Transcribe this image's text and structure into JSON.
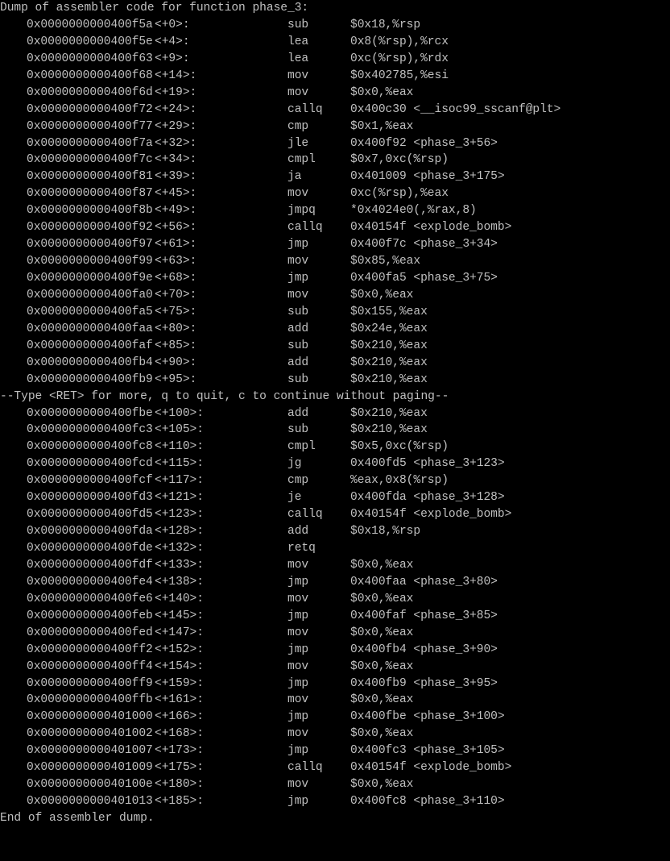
{
  "terminal": {
    "header": "Dump of assembler code for function phase_3:",
    "pager_prompt": "--Type <RET> for more, q to quit, c to continue without paging--",
    "footer": "End of assembler dump.",
    "colors": {
      "background": "#000000",
      "text": "#c0c0c0"
    },
    "instructions_part1": [
      {
        "address": "0x0000000000400f5a",
        "offset": "<+0>:",
        "mnemonic": "sub",
        "operands": "$0x18,%rsp"
      },
      {
        "address": "0x0000000000400f5e",
        "offset": "<+4>:",
        "mnemonic": "lea",
        "operands": "0x8(%rsp),%rcx"
      },
      {
        "address": "0x0000000000400f63",
        "offset": "<+9>:",
        "mnemonic": "lea",
        "operands": "0xc(%rsp),%rdx"
      },
      {
        "address": "0x0000000000400f68",
        "offset": "<+14>:",
        "mnemonic": "mov",
        "operands": "$0x402785,%esi"
      },
      {
        "address": "0x0000000000400f6d",
        "offset": "<+19>:",
        "mnemonic": "mov",
        "operands": "$0x0,%eax"
      },
      {
        "address": "0x0000000000400f72",
        "offset": "<+24>:",
        "mnemonic": "callq",
        "operands": "0x400c30 <__isoc99_sscanf@plt>"
      },
      {
        "address": "0x0000000000400f77",
        "offset": "<+29>:",
        "mnemonic": "cmp",
        "operands": "$0x1,%eax"
      },
      {
        "address": "0x0000000000400f7a",
        "offset": "<+32>:",
        "mnemonic": "jle",
        "operands": "0x400f92 <phase_3+56>"
      },
      {
        "address": "0x0000000000400f7c",
        "offset": "<+34>:",
        "mnemonic": "cmpl",
        "operands": "$0x7,0xc(%rsp)"
      },
      {
        "address": "0x0000000000400f81",
        "offset": "<+39>:",
        "mnemonic": "ja",
        "operands": "0x401009 <phase_3+175>"
      },
      {
        "address": "0x0000000000400f87",
        "offset": "<+45>:",
        "mnemonic": "mov",
        "operands": "0xc(%rsp),%eax"
      },
      {
        "address": "0x0000000000400f8b",
        "offset": "<+49>:",
        "mnemonic": "jmpq",
        "operands": "*0x4024e0(,%rax,8)"
      },
      {
        "address": "0x0000000000400f92",
        "offset": "<+56>:",
        "mnemonic": "callq",
        "operands": "0x40154f <explode_bomb>"
      },
      {
        "address": "0x0000000000400f97",
        "offset": "<+61>:",
        "mnemonic": "jmp",
        "operands": "0x400f7c <phase_3+34>"
      },
      {
        "address": "0x0000000000400f99",
        "offset": "<+63>:",
        "mnemonic": "mov",
        "operands": "$0x85,%eax"
      },
      {
        "address": "0x0000000000400f9e",
        "offset": "<+68>:",
        "mnemonic": "jmp",
        "operands": "0x400fa5 <phase_3+75>"
      },
      {
        "address": "0x0000000000400fa0",
        "offset": "<+70>:",
        "mnemonic": "mov",
        "operands": "$0x0,%eax"
      },
      {
        "address": "0x0000000000400fa5",
        "offset": "<+75>:",
        "mnemonic": "sub",
        "operands": "$0x155,%eax"
      },
      {
        "address": "0x0000000000400faa",
        "offset": "<+80>:",
        "mnemonic": "add",
        "operands": "$0x24e,%eax"
      },
      {
        "address": "0x0000000000400faf",
        "offset": "<+85>:",
        "mnemonic": "sub",
        "operands": "$0x210,%eax"
      },
      {
        "address": "0x0000000000400fb4",
        "offset": "<+90>:",
        "mnemonic": "add",
        "operands": "$0x210,%eax"
      },
      {
        "address": "0x0000000000400fb9",
        "offset": "<+95>:",
        "mnemonic": "sub",
        "operands": "$0x210,%eax"
      }
    ],
    "instructions_part2": [
      {
        "address": "0x0000000000400fbe",
        "offset": "<+100>:",
        "mnemonic": "add",
        "operands": "$0x210,%eax"
      },
      {
        "address": "0x0000000000400fc3",
        "offset": "<+105>:",
        "mnemonic": "sub",
        "operands": "$0x210,%eax"
      },
      {
        "address": "0x0000000000400fc8",
        "offset": "<+110>:",
        "mnemonic": "cmpl",
        "operands": "$0x5,0xc(%rsp)"
      },
      {
        "address": "0x0000000000400fcd",
        "offset": "<+115>:",
        "mnemonic": "jg",
        "operands": "0x400fd5 <phase_3+123>"
      },
      {
        "address": "0x0000000000400fcf",
        "offset": "<+117>:",
        "mnemonic": "cmp",
        "operands": "%eax,0x8(%rsp)"
      },
      {
        "address": "0x0000000000400fd3",
        "offset": "<+121>:",
        "mnemonic": "je",
        "operands": "0x400fda <phase_3+128>"
      },
      {
        "address": "0x0000000000400fd5",
        "offset": "<+123>:",
        "mnemonic": "callq",
        "operands": "0x40154f <explode_bomb>"
      },
      {
        "address": "0x0000000000400fda",
        "offset": "<+128>:",
        "mnemonic": "add",
        "operands": "$0x18,%rsp"
      },
      {
        "address": "0x0000000000400fde",
        "offset": "<+132>:",
        "mnemonic": "retq",
        "operands": ""
      },
      {
        "address": "0x0000000000400fdf",
        "offset": "<+133>:",
        "mnemonic": "mov",
        "operands": "$0x0,%eax"
      },
      {
        "address": "0x0000000000400fe4",
        "offset": "<+138>:",
        "mnemonic": "jmp",
        "operands": "0x400faa <phase_3+80>"
      },
      {
        "address": "0x0000000000400fe6",
        "offset": "<+140>:",
        "mnemonic": "mov",
        "operands": "$0x0,%eax"
      },
      {
        "address": "0x0000000000400feb",
        "offset": "<+145>:",
        "mnemonic": "jmp",
        "operands": "0x400faf <phase_3+85>"
      },
      {
        "address": "0x0000000000400fed",
        "offset": "<+147>:",
        "mnemonic": "mov",
        "operands": "$0x0,%eax"
      },
      {
        "address": "0x0000000000400ff2",
        "offset": "<+152>:",
        "mnemonic": "jmp",
        "operands": "0x400fb4 <phase_3+90>"
      },
      {
        "address": "0x0000000000400ff4",
        "offset": "<+154>:",
        "mnemonic": "mov",
        "operands": "$0x0,%eax"
      },
      {
        "address": "0x0000000000400ff9",
        "offset": "<+159>:",
        "mnemonic": "jmp",
        "operands": "0x400fb9 <phase_3+95>"
      },
      {
        "address": "0x0000000000400ffb",
        "offset": "<+161>:",
        "mnemonic": "mov",
        "operands": "$0x0,%eax"
      },
      {
        "address": "0x0000000000401000",
        "offset": "<+166>:",
        "mnemonic": "jmp",
        "operands": "0x400fbe <phase_3+100>"
      },
      {
        "address": "0x0000000000401002",
        "offset": "<+168>:",
        "mnemonic": "mov",
        "operands": "$0x0,%eax"
      },
      {
        "address": "0x0000000000401007",
        "offset": "<+173>:",
        "mnemonic": "jmp",
        "operands": "0x400fc3 <phase_3+105>"
      },
      {
        "address": "0x0000000000401009",
        "offset": "<+175>:",
        "mnemonic": "callq",
        "operands": "0x40154f <explode_bomb>"
      },
      {
        "address": "0x000000000040100e",
        "offset": "<+180>:",
        "mnemonic": "mov",
        "operands": "$0x0,%eax"
      },
      {
        "address": "0x0000000000401013",
        "offset": "<+185>:",
        "mnemonic": "jmp",
        "operands": "0x400fc8 <phase_3+110>"
      }
    ]
  }
}
